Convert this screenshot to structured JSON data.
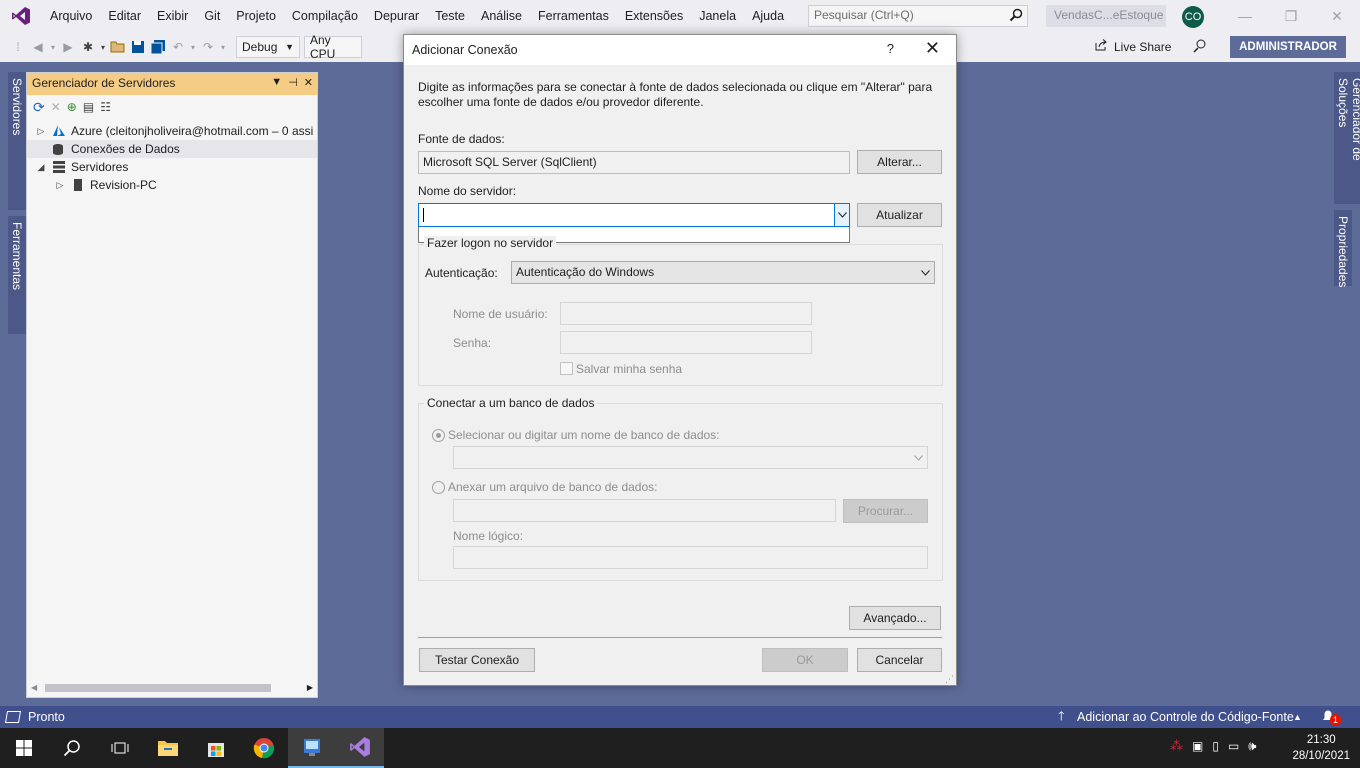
{
  "menu": {
    "items": [
      "Arquivo",
      "Editar",
      "Exibir",
      "Git",
      "Projeto",
      "Compilação",
      "Depurar",
      "Teste",
      "Análise",
      "Ferramentas",
      "Extensões",
      "Janela",
      "Ajuda"
    ],
    "search_placeholder": "Pesquisar (Ctrl+Q)",
    "solution_name": "VendasC...eEstoque",
    "avatar_initials": "CO"
  },
  "toolbar": {
    "config": "Debug",
    "platform": "Any CPU",
    "live_share": "Live Share",
    "admin": "ADMINISTRADOR"
  },
  "side_tabs": {
    "left": [
      "Gerenciador de Servidores",
      "Caixa de Ferramentas"
    ],
    "right": [
      "Gerenciador de Soluções",
      "Propriedades"
    ]
  },
  "server_explorer": {
    "title": "Gerenciador de Servidores",
    "tree": [
      {
        "label": "Azure (cleitonjholiveira@hotmail.com – 0 assi",
        "icon": "azure-icon",
        "expander": "collapsed",
        "indent": 0
      },
      {
        "label": "Conexões de Dados",
        "icon": "data-connections-icon",
        "expander": "none",
        "indent": 0,
        "selected": true
      },
      {
        "label": "Servidores",
        "icon": "servers-icon",
        "expander": "expanded",
        "indent": 0
      },
      {
        "label": "Revision-PC",
        "icon": "server-icon",
        "expander": "collapsed",
        "indent": 1
      }
    ]
  },
  "status": {
    "ready": "Pronto",
    "source_control": "Adicionar ao Controle do Código-Fonte",
    "notification_count": "1"
  },
  "clock": {
    "time": "21:30",
    "date": "28/10/2021"
  },
  "dialog": {
    "title": "Adicionar Conexão",
    "help": "?",
    "intro": "Digite as informações para se conectar à fonte de dados selecionada ou clique em \"Alterar\" para escolher uma fonte de dados e/ou provedor diferente.",
    "data_source_label": "Fonte de dados:",
    "data_source_value": "Microsoft SQL Server (SqlClient)",
    "change_button": "Alterar...",
    "server_name_label": "Nome do servidor:",
    "server_name_value": "",
    "refresh_button": "Atualizar",
    "logon_group": "Fazer logon no servidor",
    "auth_label": "Autenticação:",
    "auth_value": "Autenticação do Windows",
    "username_label": "Nome de usuário:",
    "password_label": "Senha:",
    "save_password": "Salvar minha senha",
    "connect_group": "Conectar a um banco de dados",
    "select_db_option": "Selecionar ou digitar um nome de banco de dados:",
    "attach_option": "Anexar um arquivo de banco de dados:",
    "browse_button": "Procurar...",
    "logical_name_label": "Nome lógico:",
    "advanced_button": "Avançado...",
    "test_button": "Testar Conexão",
    "ok_button": "OK",
    "cancel_button": "Cancelar"
  },
  "colors": {
    "accent": "#5d6b99",
    "statusbar": "#40508d",
    "tool_window_title": "#f5cc84",
    "focus": "#0078d7"
  }
}
